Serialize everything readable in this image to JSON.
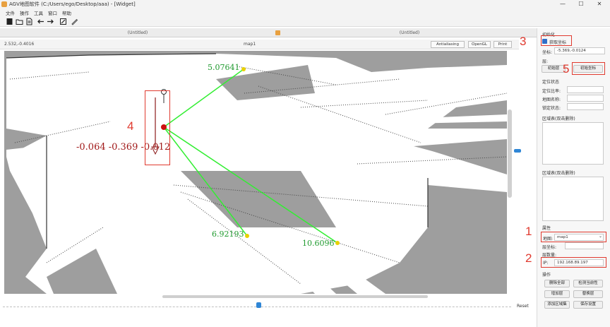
{
  "window": {
    "title": "AGV地图软件 (C:/Users/ego/Desktop/aaa) - [Widget]",
    "minimize": "—",
    "maximize": "☐",
    "close": "✕"
  },
  "menu": [
    "文件",
    "操作",
    "工具",
    "窗口",
    "帮助"
  ],
  "toolbar_icons": [
    "new-file-icon",
    "open-folder-icon",
    "save-icon",
    "undo-icon",
    "redo-icon",
    "edit-icon",
    "pen-icon"
  ],
  "tabs": [
    {
      "label": "(Untitled)"
    },
    {
      "label": "(Untitled)"
    }
  ],
  "view": {
    "coord_readout": "2.532,-0.4016",
    "map_name": "map1",
    "buttons": [
      "Antialiasing",
      "OpenGL",
      "Print"
    ],
    "reset": "Reset"
  },
  "map": {
    "robot_pose": "-0.064 -0.369 -0.012",
    "distances": [
      "5.07641",
      "6.92193",
      "10.6096"
    ]
  },
  "panel": {
    "section_title": "初始化",
    "get_pose": "获取坐标",
    "pose_label": "坐标:",
    "pose_value": "-5.369,-0.0124",
    "floor_label": "层:",
    "initial_label": "初始层",
    "initial_pose_button": "初始坐标",
    "locate_section": "定位状态",
    "locate_rate": "定位比率:",
    "map_name_label": "地图名称:",
    "lock_status": "锁定状态:",
    "zone_a": "区域表(双击删除)",
    "zone_b": "区域表(双击删除)",
    "props": "属性",
    "map_label": "地图:",
    "map_value": "map1",
    "floor_coord": "层坐标:",
    "layer_count": "层数量:",
    "ip_label": "IP:",
    "ip_value": "192.168.89.197",
    "ops": "操作",
    "buttons": [
      "删除全部",
      "检测当前性",
      "增加层",
      "替换层",
      "添加区域集",
      "保存设置"
    ]
  },
  "callouts": [
    "1",
    "2",
    "3",
    "4",
    "5"
  ],
  "colors": {
    "callout": "#e03a2f",
    "laser_line": "#33ee33",
    "robot_marker": "#cc1111",
    "pose_text": "#a01818",
    "distance_text": "#1f9a2e",
    "accent_blue": "#2f86d6"
  }
}
